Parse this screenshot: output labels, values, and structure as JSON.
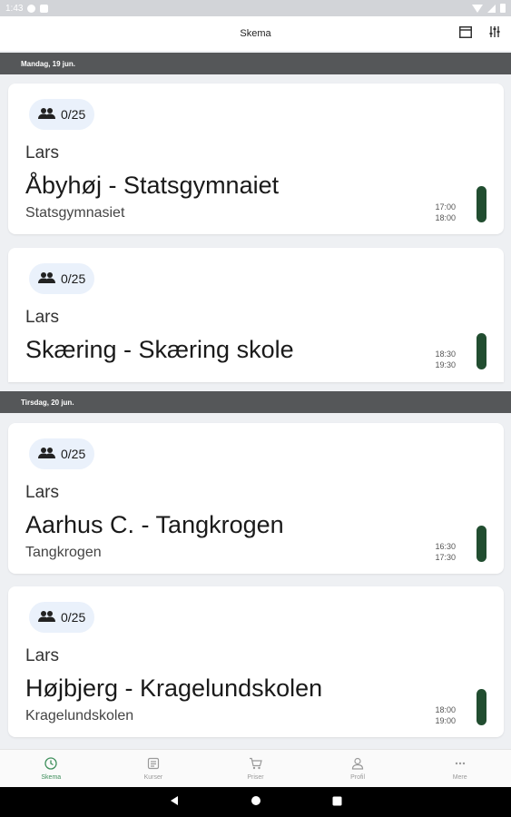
{
  "status_bar": {
    "time": "1:43"
  },
  "app_bar": {
    "title": "Skema",
    "icons": [
      "calendar-view-icon",
      "filter-icon"
    ]
  },
  "days": [
    {
      "label": "Mandag, 19 jun.",
      "sessions": [
        {
          "participants": "0/25",
          "instructor": "Lars",
          "title": "Åbyhøj - Statsgymnaiet",
          "location": "Statsgymnasiet",
          "start": "17:00",
          "end": "18:00",
          "status_color": "#214d30"
        },
        {
          "participants": "0/25",
          "instructor": "Lars",
          "title": "Skæring - Skæring skole",
          "location": "",
          "start": "18:30",
          "end": "19:30",
          "status_color": "#214d30"
        }
      ]
    },
    {
      "label": "Tirsdag, 20 jun.",
      "sessions": [
        {
          "participants": "0/25",
          "instructor": "Lars",
          "title": "Aarhus C. - Tangkrogen",
          "location": "Tangkrogen",
          "start": "16:30",
          "end": "17:30",
          "status_color": "#214d30"
        },
        {
          "participants": "0/25",
          "instructor": "Lars",
          "title": "Højbjerg - Kragelundskolen",
          "location": "Kragelundskolen",
          "start": "18:00",
          "end": "19:00",
          "status_color": "#214d30"
        }
      ]
    }
  ],
  "bottom_nav": [
    {
      "label": "Skema",
      "icon": "clock-icon",
      "active": true
    },
    {
      "label": "Kurser",
      "icon": "list-icon",
      "active": false
    },
    {
      "label": "Priser",
      "icon": "cart-icon",
      "active": false
    },
    {
      "label": "Profil",
      "icon": "person-icon",
      "active": false
    },
    {
      "label": "Mere",
      "icon": "more-icon",
      "active": false
    }
  ],
  "colors": {
    "accent": "#3f8f5c",
    "status_green": "#214d30",
    "day_header": "#555759"
  }
}
